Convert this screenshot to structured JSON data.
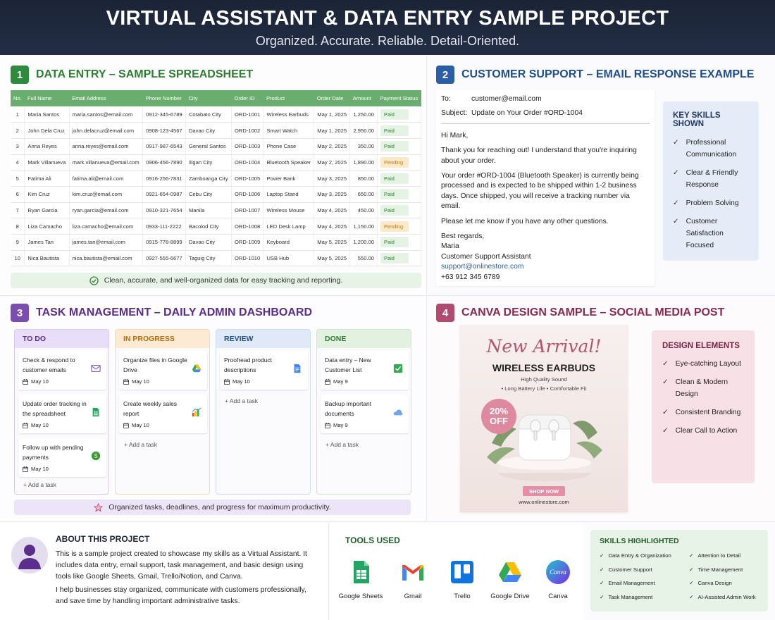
{
  "header": {
    "title": "VIRTUAL ASSISTANT & DATA ENTRY SAMPLE PROJECT",
    "subtitle": "Organized. Accurate. Reliable. Detail-Oriented."
  },
  "section1": {
    "number": "1",
    "title": "DATA ENTRY – SAMPLE SPREADSHEET",
    "columns": [
      "No.",
      "Full Name",
      "Email Address",
      "Phone Number",
      "City",
      "Order ID",
      "Product",
      "Order Date",
      "Amount",
      "Payment Status"
    ],
    "rows": [
      [
        "1",
        "Maria Santos",
        "maria.santos@email.com",
        "0912-345-6789",
        "Cotabato City",
        "ORD-1001",
        "Wireless Earbuds",
        "May 1, 2025",
        "1,250.00",
        "Paid"
      ],
      [
        "2",
        "John Dela Cruz",
        "john.delacruz@email.com",
        "0908-123-4567",
        "Davao City",
        "ORD-1002",
        "Smart Watch",
        "May 1, 2025",
        "2,950.00",
        "Paid"
      ],
      [
        "3",
        "Anna Reyes",
        "anna.reyes@email.com",
        "0917-987-6543",
        "General Santos",
        "ORD-1003",
        "Phone Case",
        "May 2, 2025",
        "350.00",
        "Paid"
      ],
      [
        "4",
        "Mark Villanueva",
        "mark.villanueva@email.com",
        "0906-456-7890",
        "Iligan City",
        "ORD-1004",
        "Bluetooth Speaker",
        "May 2, 2025",
        "1,890.00",
        "Pending"
      ],
      [
        "5",
        "Fatima Ali",
        "fatima.ali@email.com",
        "0916-256-7831",
        "Zamboanga City",
        "ORD-1005",
        "Power Bank",
        "May 3, 2025",
        "850.00",
        "Paid"
      ],
      [
        "6",
        "Kim Cruz",
        "kim.cruz@email.com",
        "0921-654-0987",
        "Cebu City",
        "ORD-1006",
        "Laptop Stand",
        "May 3, 2025",
        "650.00",
        "Paid"
      ],
      [
        "7",
        "Ryan Garcia",
        "ryan.garcia@email.com",
        "0910-321-7654",
        "Manila",
        "ORD-1007",
        "Wireless Mouse",
        "May 4, 2025",
        "450.00",
        "Paid"
      ],
      [
        "8",
        "Liza Camacho",
        "liza.camacho@email.com",
        "0933-111-2222",
        "Bacolod City",
        "ORD-1008",
        "LED Desk Lamp",
        "May 4, 2025",
        "1,150.00",
        "Pending"
      ],
      [
        "9",
        "James Tan",
        "james.tan@email.com",
        "0915-778-8899",
        "Davao City",
        "ORD-1009",
        "Keyboard",
        "May 5, 2025",
        "1,200.00",
        "Paid"
      ],
      [
        "10",
        "Nica Bautista",
        "nica.bautista@email.com",
        "0927-555-6677",
        "Taguig City",
        "ORD-1010",
        "USB Hub",
        "May 5, 2025",
        "550.00",
        "Paid"
      ]
    ],
    "note": "Clean, accurate, and well-organized data for easy tracking and reporting.",
    "colors": {
      "header": "#6aae6f",
      "paid": "#e4f3e4",
      "pending": "#fde9c8"
    }
  },
  "section2": {
    "number": "2",
    "title": "CUSTOMER SUPPORT – EMAIL RESPONSE EXAMPLE",
    "email": {
      "to_label": "To:",
      "to": "customer@email.com",
      "subject_label": "Subject:",
      "subject": "Update on Your Order #ORD-1004",
      "greeting": "Hi Mark,",
      "p1": "Thank you for reaching out! I understand that you're inquiring about your order.",
      "p2": "Your order #ORD-1004 (Bluetooth Speaker) is currently being processed and is expected to be shipped within 1-2 business days. Once shipped, you will receive a tracking number via email.",
      "p3": "Please let me know if you have any other questions.",
      "closing": "Best regards,",
      "name": "Maria",
      "role": "Customer Support Assistant",
      "email_addr": "support@onlinestore.com",
      "phone": "+63 912 345 6789"
    },
    "skills_title": "KEY SKILLS SHOWN",
    "skills": [
      "Professional Communication",
      "Clear & Friendly Response",
      "Problem Solving",
      "Customer Satisfaction Focused"
    ]
  },
  "section3": {
    "number": "3",
    "title": "TASK MANAGEMENT – DAILY ADMIN DASHBOARD",
    "columns": [
      {
        "name": "TO DO",
        "color": "#e9def7",
        "text": "#5b2d8c",
        "border": "#d9c8ef",
        "cards": [
          {
            "title": "Check & respond to customer emails",
            "date": "May 10",
            "icon": "mail-icon"
          },
          {
            "title": "Update order tracking in the spreadsheet",
            "date": "May 10",
            "icon": "sheets-icon"
          },
          {
            "title": "Follow up with pending payments",
            "date": "May 10",
            "icon": "dollar-icon"
          }
        ]
      },
      {
        "name": "IN PROGRESS",
        "color": "#fcebd2",
        "text": "#b66d0d",
        "border": "#f5dcb2",
        "cards": [
          {
            "title": "Organize files in Google Drive",
            "date": "May 10",
            "icon": "drive-icon"
          },
          {
            "title": "Create weekly sales report",
            "date": "May 10",
            "icon": "chart-icon"
          }
        ]
      },
      {
        "name": "REVIEW",
        "color": "#e0e9f7",
        "text": "#1f4e8c",
        "border": "#cfdcf0",
        "cards": [
          {
            "title": "Proofread product descriptions",
            "date": "May 10",
            "icon": "doc-icon"
          }
        ]
      },
      {
        "name": "DONE",
        "color": "#e3f1e1",
        "text": "#2e7d32",
        "border": "#cfe6cb",
        "cards": [
          {
            "title": "Data entry – New Customer List",
            "date": "May 9",
            "icon": "check-icon"
          },
          {
            "title": "Backup important documents",
            "date": "May 9",
            "icon": "cloud-icon"
          }
        ]
      }
    ],
    "add_task": "+ Add a task",
    "note": "Organized tasks, deadlines, and progress for maximum productivity."
  },
  "section4": {
    "number": "4",
    "title": "CANVA DESIGN SAMPLE – SOCIAL MEDIA POST",
    "poster": {
      "script": "New Arrival!",
      "product": "WIRELESS EARBUDS",
      "line1": "High Quality Sound",
      "line2": "• Long Battery Life  • Comfortable Fit",
      "badge_pct": "20%",
      "badge_off": "OFF",
      "cta": "SHOP NOW",
      "site": "www.onlinestore.com"
    },
    "elements_title": "DESIGN ELEMENTS",
    "elements": [
      "Eye-catching Layout",
      "Clean & Modern Design",
      "Consistent Branding",
      "Clear Call to Action"
    ]
  },
  "about": {
    "title": "ABOUT THIS PROJECT",
    "p1": "This is a sample project created to showcase my skills as a Virtual Assistant. It includes data entry, email support, task management, and basic design using tools like Google Sheets, Gmail, Trello/Notion, and Canva.",
    "p2": "I help businesses stay organized, communicate with customers professionally, and save time by handling important administrative tasks."
  },
  "tools": {
    "title": "TOOLS USED",
    "items": [
      "Google Sheets",
      "Gmail",
      "Trello",
      "Google Drive",
      "Canva"
    ],
    "canva_logo_text": "Canva"
  },
  "skills_highlighted": {
    "title": "SKILLS HIGHLIGHTED",
    "left": [
      "Data Entry & Organization",
      "Customer Support",
      "Email Management",
      "Task Management"
    ],
    "right": [
      "Attention to Detail",
      "Time Management",
      "Canva Design",
      "AI-Assisted Admin Work"
    ]
  }
}
